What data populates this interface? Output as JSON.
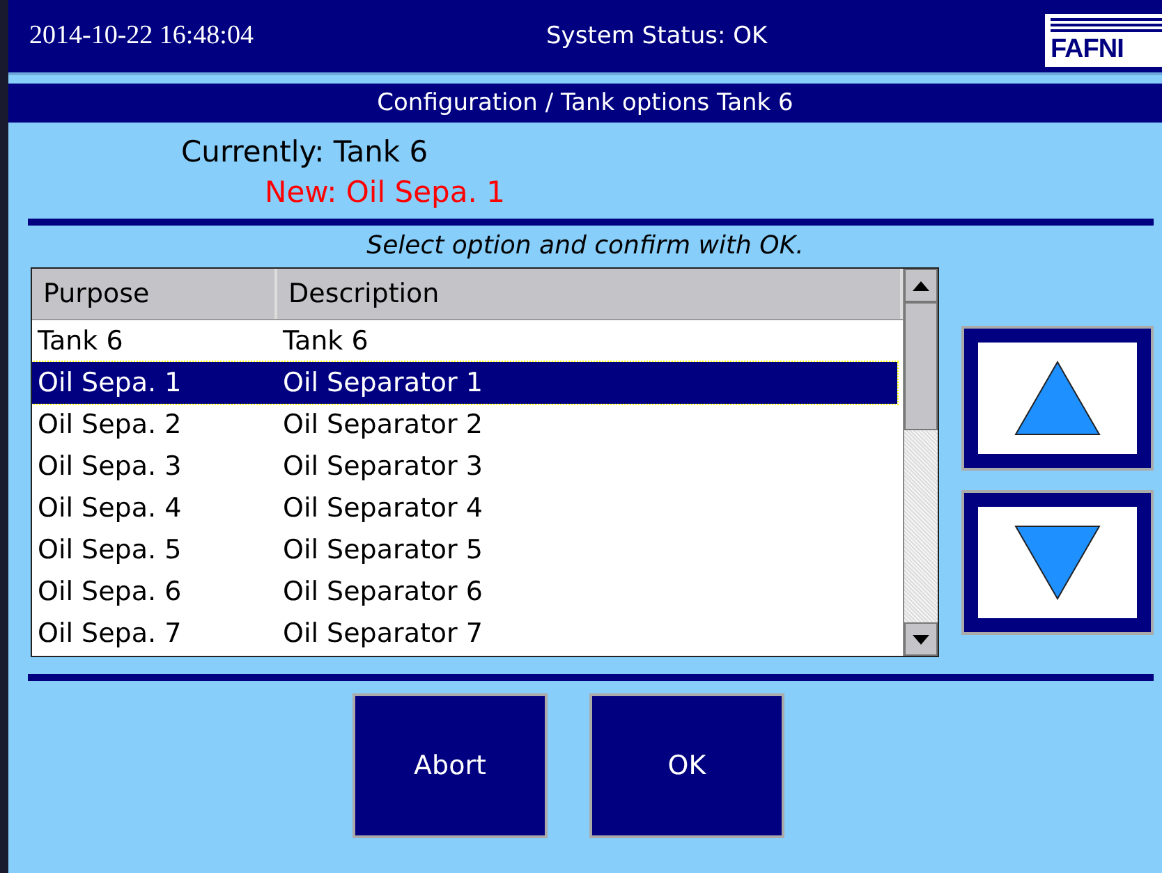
{
  "header": {
    "datetime": "2014-10-22  16:48:04",
    "status": "System Status: OK",
    "logo": "FAFNI"
  },
  "title": "Configuration / Tank options Tank 6",
  "currently": {
    "label": "Currently:",
    "value": "Tank 6"
  },
  "new": {
    "label": "New:",
    "value": "Oil Sepa. 1"
  },
  "instruction": "Select option and confirm with OK.",
  "table": {
    "columns": [
      "Purpose",
      "Description"
    ],
    "rows": [
      {
        "purpose": "Tank 6",
        "description": "Tank 6",
        "selected": false
      },
      {
        "purpose": "Oil Sepa. 1",
        "description": "Oil Separator 1",
        "selected": true
      },
      {
        "purpose": "Oil Sepa. 2",
        "description": "Oil Separator 2",
        "selected": false
      },
      {
        "purpose": "Oil Sepa. 3",
        "description": "Oil Separator 3",
        "selected": false
      },
      {
        "purpose": "Oil Sepa. 4",
        "description": "Oil Separator 4",
        "selected": false
      },
      {
        "purpose": "Oil Sepa. 5",
        "description": "Oil Separator 5",
        "selected": false
      },
      {
        "purpose": "Oil Sepa. 6",
        "description": "Oil Separator 6",
        "selected": false
      },
      {
        "purpose": "Oil Sepa. 7",
        "description": "Oil Separator 7",
        "selected": false
      }
    ]
  },
  "buttons": [
    "Abort",
    "OK"
  ]
}
